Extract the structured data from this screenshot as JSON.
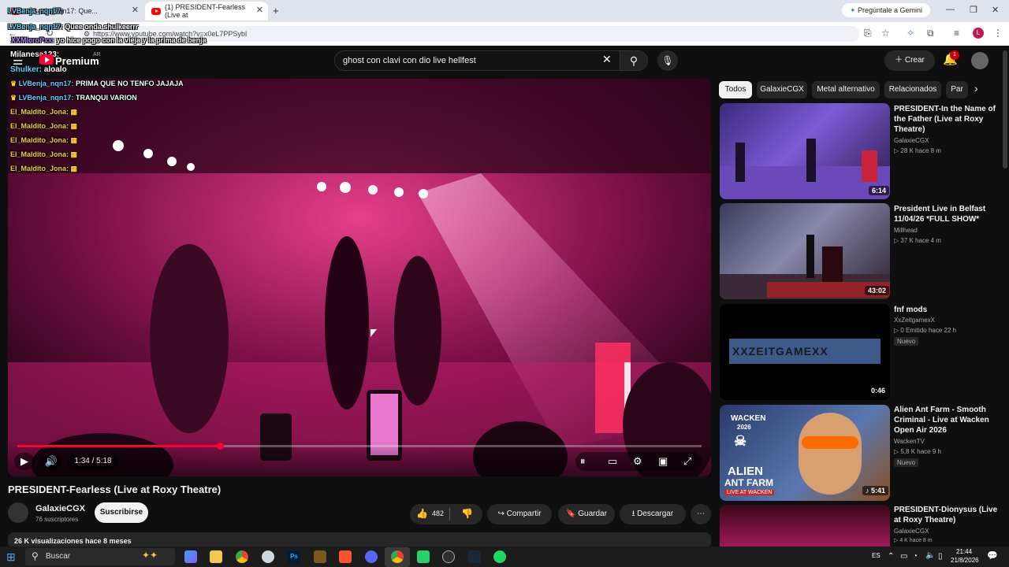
{
  "browser": {
    "tabs": [
      {
        "label": "LVBenja_nqn17: Que..."
      },
      {
        "label": "(1) PRESIDENT-Fearless (Live at"
      }
    ],
    "new_tab_symbol": "+",
    "url": "https://www.youtube.com/watch?v=x0eL7PPSybI",
    "gemini_label": "Pregúntale a Gemini",
    "profile_initial": "L"
  },
  "stream_overlay": {
    "top_chat": [
      {
        "user": "LVBenja_nqn17:",
        "msg": "Quee onda shulkeerrr"
      },
      {
        "user": "XXMicroPxx:",
        "msg": "yo hice pogo con la vieja y la prima de benja"
      }
    ],
    "streamer_line": "Milanesa123:",
    "shulker_line_user": "Shulker:",
    "shulker_line_msg": "aloalo",
    "video_chat": [
      {
        "user": "LVBenja_nqn17:",
        "msg": "PRIMA QUE NO TENFO JAJAJA",
        "color": "#5fd3ff"
      },
      {
        "user": "LVBenja_nqn17:",
        "msg": "TRANQUI VARION",
        "color": "#5fd3ff"
      },
      {
        "user": "El_Maldito_Jona:",
        "msg": "",
        "color": "#ffcc33"
      },
      {
        "user": "El_Maldito_Jona:",
        "msg": "",
        "color": "#ffcc33"
      },
      {
        "user": "El_Maldito_Jona:",
        "msg": "",
        "color": "#ffcc33"
      },
      {
        "user": "El_Maldito_Jona:",
        "msg": "",
        "color": "#ffcc33"
      },
      {
        "user": "El_Maldito_Jona:",
        "msg": "",
        "color": "#ffcc33"
      }
    ]
  },
  "masthead": {
    "logo_text": "Premium",
    "region": "AR",
    "search_value": "ghost con clavi con dio live  hellfest",
    "create_label": "Crear",
    "notif_count": "1"
  },
  "player": {
    "current_time": "1:34",
    "duration": "5:18",
    "time_label": "1:34 / 5:18",
    "progress_fraction": 0.296
  },
  "video": {
    "title": "PRESIDENT-Fearless (Live at Roxy Theatre)",
    "channel": "GalaxieCGX",
    "subscribers": "76 suscriptores",
    "subscribe_label": "Suscribirse",
    "likes": "482",
    "share_label": "Compartir",
    "save_label": "Guardar",
    "download_label": "Descargar",
    "views_line": "26 K visualizaciones  hace 8 meses"
  },
  "chips": [
    "Todos",
    "GalaxieCGX",
    "Metal alternativo",
    "Relacionados",
    "Par"
  ],
  "recommendations": [
    {
      "title": "PRESIDENT-In the Name of the Father (Live at Roxy Theatre)",
      "channel": "GalaxieCGX",
      "meta": "28 K  hace 8 m",
      "duration": "6:14",
      "badge": ""
    },
    {
      "title": "President Live in Belfast 11/04/26 *FULL SHOW*",
      "channel": "Millhead",
      "meta": "37 K  hace 4 m",
      "duration": "43:02",
      "badge": ""
    },
    {
      "title": "fnf mods",
      "channel": "XxZeitgamexX",
      "meta": "0  Emitido hace 22 h",
      "duration": "0:46",
      "badge": "Nuevo",
      "thumb_text": "XXZEITGAMEXX"
    },
    {
      "title": "Alien Ant Farm - Smooth Criminal - Live at Wacken Open Air 2026",
      "channel": "WackenTV",
      "meta": "5,8 K  hace 9 h",
      "duration": "5:41",
      "badge": "Nuevo",
      "thumb_text_1": "WACKEN",
      "thumb_text_2": "2026",
      "thumb_text_3": "ALIEN",
      "thumb_text_4": "ANT FARM",
      "thumb_text_5": "LIVE AT WACKEN"
    },
    {
      "title": "PRESIDENT-Dionysus (Live at Roxy Theatre)",
      "channel": "GalaxieCGX",
      "meta": "4 K  hace 8 m",
      "duration": "",
      "badge": ""
    }
  ],
  "taskbar": {
    "search_label": "Buscar",
    "lang": "ES",
    "time": "21:44",
    "date": "21/8/2026"
  }
}
